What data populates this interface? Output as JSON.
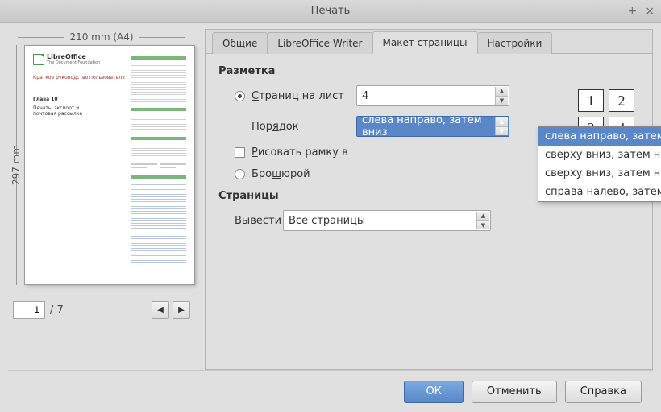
{
  "window": {
    "title": "Печать"
  },
  "preview": {
    "width_label": "210 mm (A4)",
    "height_label": "297 mm",
    "doc_subtitle_ru": "Краткое руководство пользователя",
    "chapter": "Глава 10",
    "chapter_title": "Печать, экспорт и\nпочтовая рассылка",
    "current_page": "1",
    "total_pages": "/ 7"
  },
  "tabs": [
    "Общие",
    "LibreOffice Writer",
    "Макет страницы",
    "Настройки"
  ],
  "active_tab": 2,
  "layout": {
    "section": "Разметка",
    "pages_per_sheet_label": "Страниц на лист",
    "pages_per_sheet_value": "4",
    "order_label": "Порядок",
    "order_value": "слева направо, затем вниз",
    "order_options": [
      "слева направо, затем вниз",
      "сверху вниз, затем направо",
      "сверху вниз, затем налево",
      "справа налево, затем вниз"
    ],
    "draw_border_label": "Рисовать рамку вокруг каждой страницы",
    "draw_border_visible_text": "Рисовать рамку в",
    "brochure_label": "Брошюрой",
    "nup_preview": [
      "1",
      "2",
      "3",
      "4"
    ]
  },
  "pages_section": {
    "section": "Страницы",
    "include_label": "Вывести",
    "include_value": "Все страницы"
  },
  "buttons": {
    "ok": "ОК",
    "cancel": "Отменить",
    "help": "Справка"
  }
}
